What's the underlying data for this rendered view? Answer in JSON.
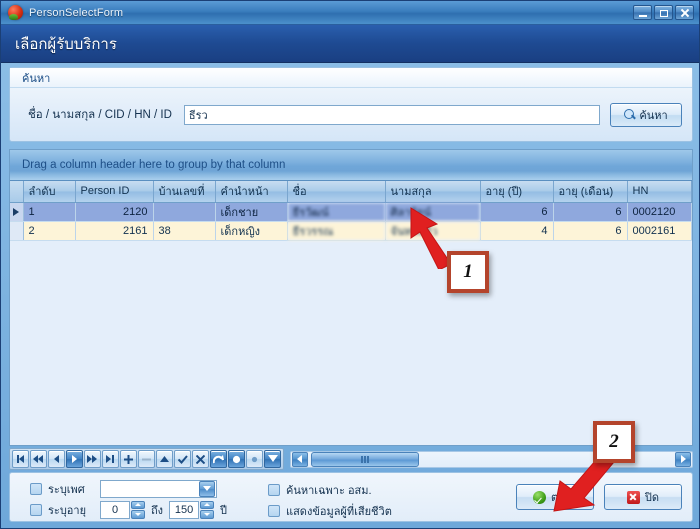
{
  "window": {
    "title": "PersonSelectForm",
    "icon": "app-icon",
    "controls": [
      {
        "name": "minimize",
        "glyph": "minimize-icon"
      },
      {
        "name": "maximize",
        "glyph": "maximize-icon"
      },
      {
        "name": "close",
        "glyph": "close-icon"
      }
    ]
  },
  "banner": {
    "title": "เลือกผู้รับบริการ"
  },
  "search": {
    "caption": "ค้นหา",
    "label": "ชื่อ / นามสกุล / CID / HN / ID",
    "value": "ธีรว",
    "placeholder": "",
    "button": "ค้นหา"
  },
  "grid": {
    "group_panel_text": "Drag a column header here to group by that column",
    "columns": [
      "ลำดับ",
      "Person ID",
      "บ้านเลขที่",
      "คำนำหน้า",
      "ชื่อ",
      "นามสกุล",
      "อายุ (ปี)",
      "อายุ (เดือน)",
      "HN"
    ],
    "rows": [
      {
        "selected": true,
        "seq": "1",
        "person_id": "2120",
        "house_no": "",
        "prefix": "เด็กชาย",
        "first_name": "ธีรวัฒน์",
        "last_name": "ศิลารัตน์",
        "age_year": "6",
        "age_month": "6",
        "hn": "0002120"
      },
      {
        "selected": false,
        "seq": "2",
        "person_id": "2161",
        "house_no": "38",
        "prefix": "เด็กหญิง",
        "first_name": "ธีรวรรณ",
        "last_name": "จันทร์แก้ว",
        "age_year": "4",
        "age_month": "6",
        "hn": "0002161"
      }
    ]
  },
  "navigator": {
    "buttons": [
      "first-record-icon",
      "prior-page-icon",
      "prior-record-icon",
      "next-record-icon",
      "next-page-icon",
      "last-record-icon",
      "insert-record-icon",
      "delete-record-icon",
      "edit-record-icon",
      "post-edit-icon",
      "cancel-edit-icon",
      "refresh-icon",
      "save-icon",
      "export-icon",
      "filter-icon"
    ],
    "active_index": 3
  },
  "scrollbar": {
    "left_arrow": "chevron-left-icon",
    "right_arrow": "chevron-right-icon"
  },
  "bottom": {
    "gender_checkbox": "ระบุเพศ",
    "gender_value": "",
    "age_checkbox": "ระบุอายุ",
    "age_from": "0",
    "age_to": "150",
    "age_between_label": "ถึง",
    "age_unit_label": "ปี",
    "osm_checkbox": "ค้นหาเฉพาะ อสม.",
    "deceased_checkbox": "แสดงข้อมูลผู้ที่เสียชีวิต",
    "ok_button": "ตกลง",
    "close_button": "ปิด"
  },
  "annotations": [
    {
      "number": "1",
      "target": "selected-row-lastname-cell"
    },
    {
      "number": "2",
      "target": "ok-button"
    }
  ],
  "colors": {
    "title_bar": "#3a7dbd",
    "banner": "#1e4a92",
    "selected_row": "#8fa8dd",
    "alt_row": "#fdf4d8",
    "grid_bg": "#e4eefa",
    "annotation_border": "#b4442c",
    "arrow": "#e02020",
    "ok_green": "#3e9e18",
    "close_red": "#c0191b"
  }
}
